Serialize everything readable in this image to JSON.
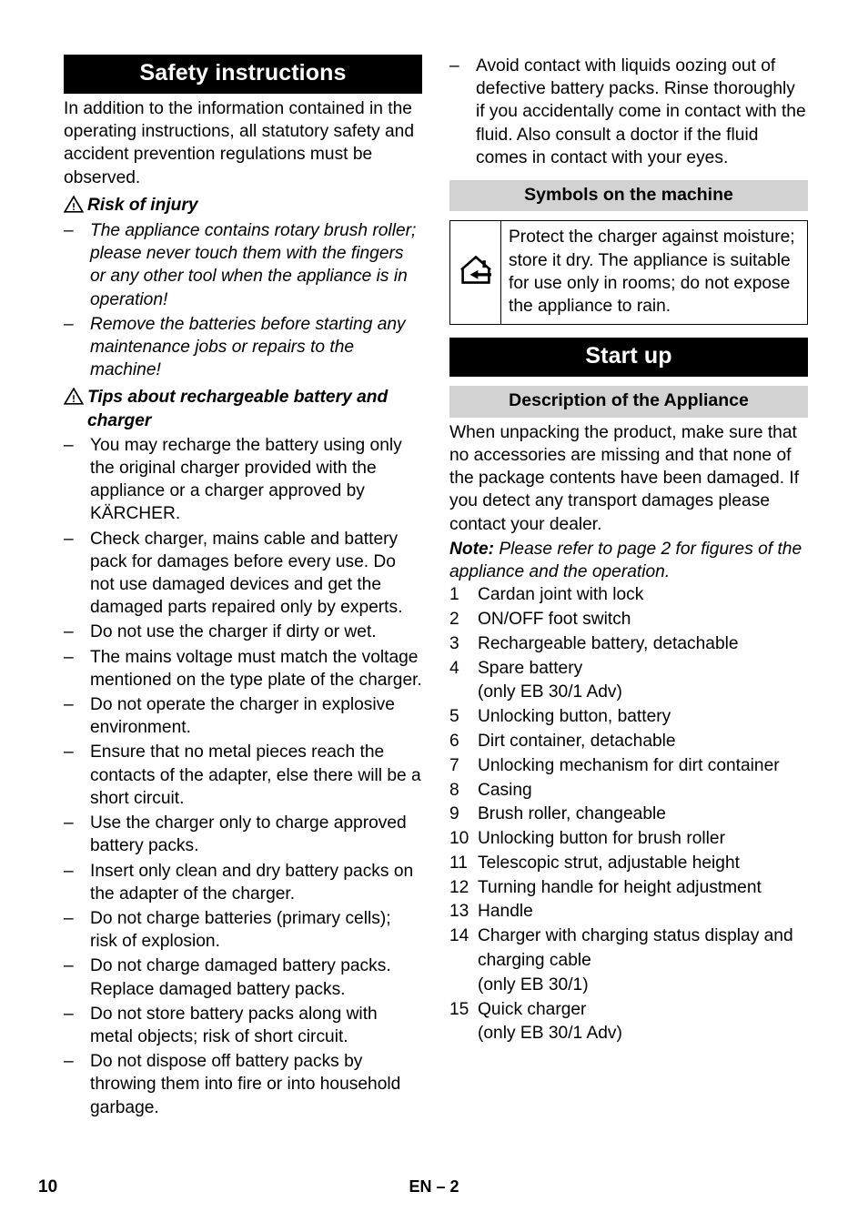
{
  "document": {
    "left_column": {
      "banner": "Safety instructions",
      "intro": "In addition to the information contained in the operating instructions, all statutory safety and accident prevention regulations must be observed.",
      "warning_1": {
        "icon": "warning-triangle-icon",
        "title": "Risk of injury",
        "items": [
          "The appliance contains rotary brush roller; please never touch them with the fingers or any other tool when the appliance is in operation!",
          "Remove the batteries before starting any maintenance jobs or repairs to the machine!"
        ]
      },
      "warning_2": {
        "icon": "warning-triangle-icon",
        "title": "Tips about rechargeable battery and charger",
        "items": [
          "You may recharge the battery using only the original charger provided with the appliance or a charger approved by KÄRCHER.",
          "Check charger, mains cable and battery pack for damages before every use. Do not use damaged devices and get the damaged parts repaired only by experts.",
          "Do not use the charger if dirty or wet.",
          "The mains voltage must match the voltage mentioned on the type plate of the charger.",
          "Do not operate the charger in explosive environment.",
          "Ensure that no metal pieces reach the contacts of the adapter, else there will be a short circuit.",
          "Use the charger only to charge approved battery packs.",
          "Insert only clean and dry battery packs on the adapter of the charger.",
          "Do not charge batteries (primary cells); risk of explosion.",
          "Do not charge damaged battery packs. Replace damaged battery packs.",
          "Do not store battery packs along with metal objects; risk of short circuit.",
          "Do not dispose off battery packs by throwing them into fire or into household garbage."
        ]
      }
    },
    "right_column": {
      "continued_item": "Avoid contact with liquids oozing out of defective battery packs. Rinse thoroughly if you accidentally come in contact with the fluid. Also consult a doctor if the fluid comes in contact with your eyes.",
      "symbols_heading": "Symbols on the machine",
      "symbol_row": {
        "icon": "indoor-use-only-house-icon",
        "text": "Protect the charger against moisture; store it dry. The appliance is suitable for use only in rooms; do not expose the appliance to rain."
      },
      "startup_banner": "Start up",
      "description_heading": "Description of the Appliance",
      "description_para": "When unpacking the product, make sure that no accessories are missing and that none of the package contents have been damaged. If you detect any transport damages please contact your dealer.",
      "note_label": "Note:",
      "note_text": " Please refer to page 2 for figures of the appliance and the operation.",
      "parts": [
        {
          "num": "1",
          "label": "Cardan joint with lock",
          "sub": ""
        },
        {
          "num": "2",
          "label": "ON/OFF foot switch",
          "sub": ""
        },
        {
          "num": "3",
          "label": "Rechargeable battery, detachable",
          "sub": ""
        },
        {
          "num": "4",
          "label": "Spare battery",
          "sub": "(only EB 30/1 Adv)"
        },
        {
          "num": "5",
          "label": "Unlocking button, battery",
          "sub": ""
        },
        {
          "num": "6",
          "label": "Dirt container, detachable",
          "sub": ""
        },
        {
          "num": "7",
          "label": "Unlocking mechanism for dirt container",
          "sub": ""
        },
        {
          "num": "8",
          "label": "Casing",
          "sub": ""
        },
        {
          "num": "9",
          "label": "Brush roller, changeable",
          "sub": ""
        },
        {
          "num": "10",
          "label": "Unlocking button for brush roller",
          "sub": ""
        },
        {
          "num": "11",
          "label": "Telescopic strut, adjustable height",
          "sub": ""
        },
        {
          "num": "12",
          "label": "Turning handle for height adjustment",
          "sub": ""
        },
        {
          "num": "13",
          "label": "Handle",
          "sub": ""
        },
        {
          "num": "14",
          "label": "Charger with charging status display and charging cable",
          "sub": "(only EB 30/1)"
        },
        {
          "num": "15",
          "label": "Quick charger",
          "sub": "(only EB 30/1 Adv)"
        }
      ]
    },
    "footer": {
      "page_number": "10",
      "language_page": "EN – 2"
    },
    "colors": {
      "banner_bg": "#000000",
      "banner_fg": "#ffffff",
      "subbar_bg": "#d2d2d2",
      "text": "#000000",
      "page_bg": "#ffffff"
    },
    "bullet_dash": "–"
  }
}
